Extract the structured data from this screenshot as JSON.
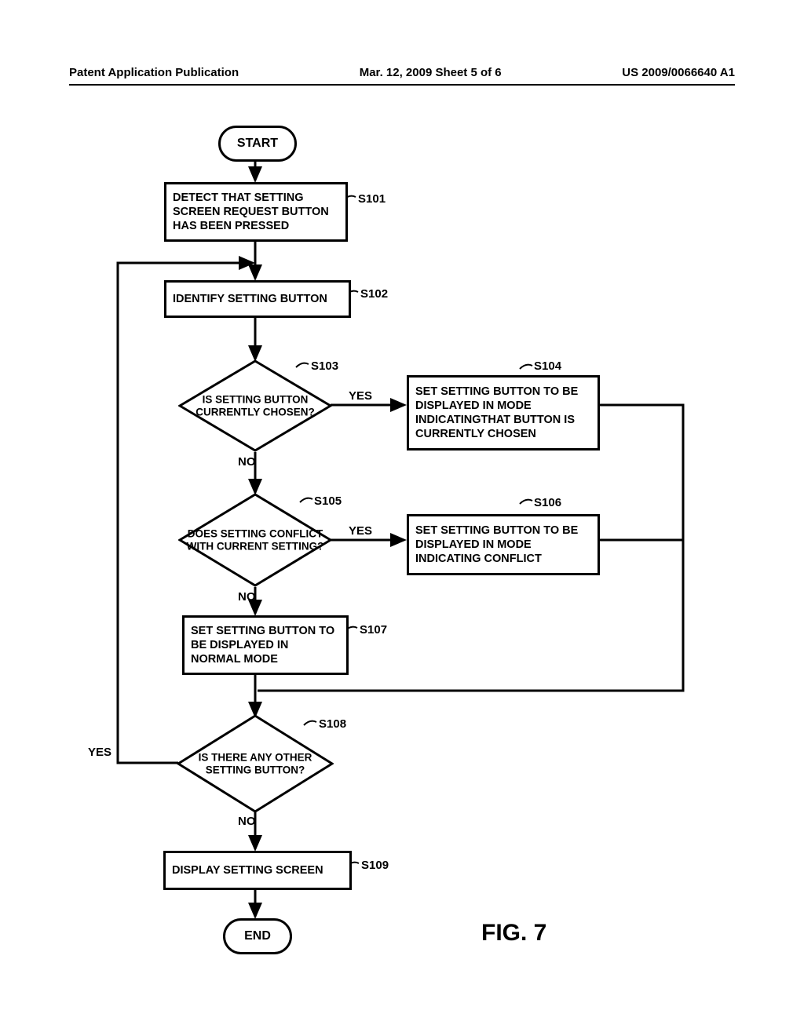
{
  "header": {
    "left": "Patent Application Publication",
    "center": "Mar. 12, 2009  Sheet 5 of 6",
    "right": "US 2009/0066640 A1"
  },
  "figure_label": "FIG. 7",
  "flow": {
    "start": "START",
    "end": "END",
    "s101": {
      "id": "S101",
      "text": "DETECT THAT SETTING SCREEN REQUEST BUTTON HAS BEEN PRESSED"
    },
    "s102": {
      "id": "S102",
      "text": "IDENTIFY SETTING BUTTON"
    },
    "s103": {
      "id": "S103",
      "text": "IS SETTING BUTTON CURRENTLY CHOSEN?",
      "yes": "YES",
      "no": "NO"
    },
    "s104": {
      "id": "S104",
      "text": "SET SETTING BUTTON TO BE DISPLAYED IN MODE INDICATINGTHAT BUTTON IS CURRENTLY CHOSEN"
    },
    "s105": {
      "id": "S105",
      "text": "DOES SETTING CONFLICT WITH CURRENT SETTING?",
      "yes": "YES",
      "no": "NO"
    },
    "s106": {
      "id": "S106",
      "text": "SET SETTING BUTTON TO BE DISPLAYED IN MODE INDICATING CONFLICT"
    },
    "s107": {
      "id": "S107",
      "text": "SET SETTING BUTTON TO BE DISPLAYED IN NORMAL MODE"
    },
    "s108": {
      "id": "S108",
      "text": "IS THERE ANY OTHER SETTING BUTTON?",
      "yes": "YES",
      "no": "NO"
    },
    "s109": {
      "id": "S109",
      "text": "DISPLAY SETTING SCREEN"
    }
  }
}
